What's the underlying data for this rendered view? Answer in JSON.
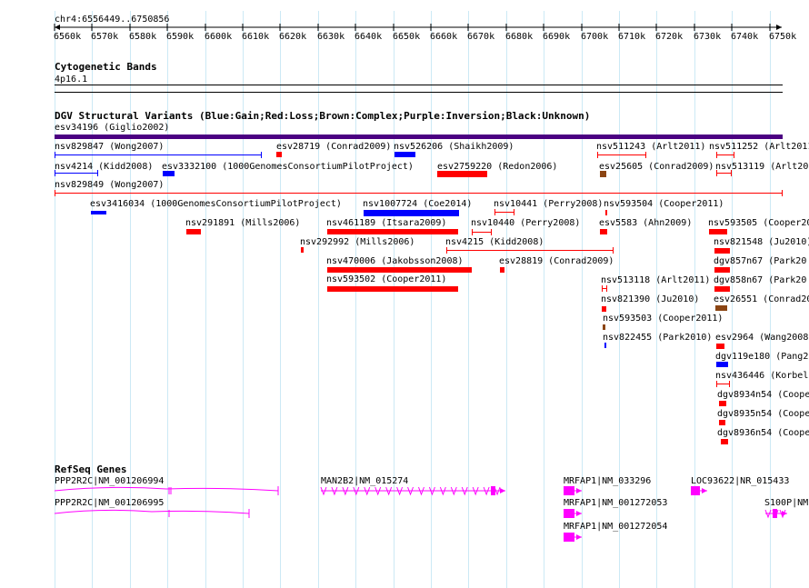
{
  "ruler": {
    "location": "chr4:6556449..6750856",
    "ticks": [
      "6560k",
      "6570k",
      "6580k",
      "6590k",
      "6600k",
      "6610k",
      "6620k",
      "6630k",
      "6640k",
      "6650k",
      "6660k",
      "6670k",
      "6680k",
      "6690k",
      "6700k",
      "6710k",
      "6720k",
      "6730k",
      "6740k",
      "6750k"
    ]
  },
  "cytoband": {
    "title": "Cytogenetic Bands",
    "band": "4p16.1"
  },
  "dgv": {
    "title": "DGV Structural Variants (Blue:Gain;Red:Loss;Brown:Complex;Purple:Inversion;Black:Unknown)",
    "colors": {
      "gain": "#0000ff",
      "loss": "#ff0000",
      "complex": "#8b4513",
      "inversion": "#4b0082",
      "unknown": "#000000"
    },
    "variants": [
      {
        "label": "esv34196 (Giglio2002)",
        "type": "inversion"
      },
      {
        "label": "nsv829847 (Wong2007)",
        "type": "gain"
      },
      {
        "label": "esv28719 (Conrad2009)",
        "type": "loss"
      },
      {
        "label": "nsv526206 (Shaikh2009)",
        "type": "gain"
      },
      {
        "label": "nsv511243 (Arlt2011)",
        "type": "loss"
      },
      {
        "label": "nsv511252 (Arlt2011",
        "type": "loss"
      },
      {
        "label": "nsv4214 (Kidd2008)",
        "type": "gain"
      },
      {
        "label": "esv3332100 (1000GenomesConsortiumPilotProject)",
        "type": "gain"
      },
      {
        "label": "esv2759220 (Redon2006)",
        "type": "loss"
      },
      {
        "label": "esv25605 (Conrad2009)",
        "type": "complex"
      },
      {
        "label": "nsv513119 (Arlt20",
        "type": "loss"
      },
      {
        "label": "nsv829849 (Wong2007)",
        "type": "loss"
      },
      {
        "label": "esv3416034 (1000GenomesConsortiumPilotProject)",
        "type": "gain"
      },
      {
        "label": "nsv1007724 (Coe2014)",
        "type": "gain"
      },
      {
        "label": "nsv10441 (Perry2008)",
        "type": "loss"
      },
      {
        "label": "nsv593504 (Cooper2011)",
        "type": "loss"
      },
      {
        "label": "nsv291891 (Mills2006)",
        "type": "loss"
      },
      {
        "label": "nsv461189 (Itsara2009)",
        "type": "loss"
      },
      {
        "label": "nsv10440 (Perry2008)",
        "type": "loss"
      },
      {
        "label": "esv5583 (Ahn2009)",
        "type": "loss"
      },
      {
        "label": "nsv593505 (Cooper20",
        "type": "loss"
      },
      {
        "label": "nsv292992 (Mills2006)",
        "type": "loss"
      },
      {
        "label": "nsv4215 (Kidd2008)",
        "type": "loss"
      },
      {
        "label": "nsv821548 (Ju2010)",
        "type": "loss"
      },
      {
        "label": "nsv470006 (Jakobsson2008)",
        "type": "loss"
      },
      {
        "label": "esv28819 (Conrad2009)",
        "type": "loss"
      },
      {
        "label": "dgv857n67 (Park20",
        "type": "loss"
      },
      {
        "label": "nsv593502 (Cooper2011)",
        "type": "loss"
      },
      {
        "label": "nsv513118 (Arlt2011)",
        "type": "loss"
      },
      {
        "label": "dgv858n67 (Park20",
        "type": "loss"
      },
      {
        "label": "nsv821390 (Ju2010)",
        "type": "loss"
      },
      {
        "label": "esv26551 (Conrad20",
        "type": "complex"
      },
      {
        "label": "nsv593503 (Cooper2011)",
        "type": "complex"
      },
      {
        "label": "nsv822455 (Park2010)",
        "type": "gain"
      },
      {
        "label": "esv2964 (Wang2008",
        "type": "loss"
      },
      {
        "label": "dgv119e180 (Pang2",
        "type": "gain"
      },
      {
        "label": "nsv436446 (Korbel",
        "type": "loss"
      },
      {
        "label": "dgv8934n54 (Coope",
        "type": "loss"
      },
      {
        "label": "dgv8935n54 (Coope",
        "type": "loss"
      },
      {
        "label": "dgv8936n54 (Coope",
        "type": "loss"
      }
    ]
  },
  "refseq": {
    "title": "RefSeq Genes",
    "color": "#ff00ff",
    "genes": [
      {
        "label": "PPP2R2C|NM_001206994"
      },
      {
        "label": "PPP2R2C|NM_001206995"
      },
      {
        "label": "MAN2B2|NM_015274"
      },
      {
        "label": "MRFAP1|NM_033296"
      },
      {
        "label": "MRFAP1|NM_001272053"
      },
      {
        "label": "MRFAP1|NM_001272054"
      },
      {
        "label": "LOC93622|NR_015433"
      },
      {
        "label": "S100P|NM"
      }
    ]
  }
}
